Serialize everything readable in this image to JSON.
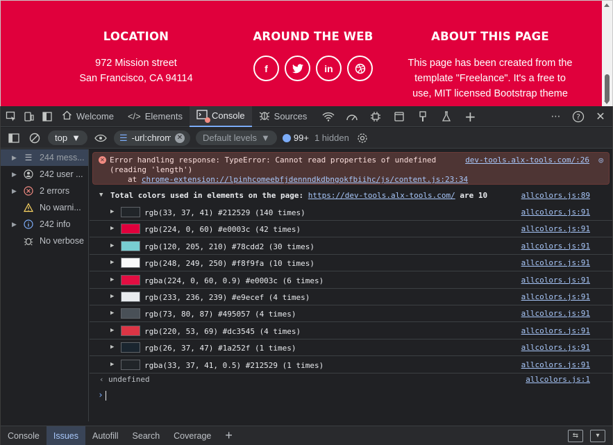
{
  "webpage": {
    "location": {
      "heading": "LOCATION",
      "line1": "972 Mission street",
      "line2": "San Francisco, CA 94114"
    },
    "around": {
      "heading": "AROUND THE WEB",
      "social": [
        {
          "icon": "facebook-icon",
          "glyph": "f"
        },
        {
          "icon": "twitter-icon",
          "glyph": "🐦"
        },
        {
          "icon": "linkedin-icon",
          "glyph": "in"
        },
        {
          "icon": "dribbble-icon",
          "glyph": "◎"
        }
      ]
    },
    "about": {
      "heading": "ABOUT THIS PAGE",
      "line1": "This page has been created from the",
      "line2": "template \"Freelance\". It's a free to",
      "line3": "use, MIT licensed Bootstrap theme"
    },
    "accent_color": "#e0003c"
  },
  "tabbar": {
    "tabs": [
      {
        "label": "Welcome",
        "icon": "home-icon"
      },
      {
        "label": "Elements",
        "icon": "code-icon"
      },
      {
        "label": "Console",
        "icon": "console-icon",
        "active": true
      },
      {
        "label": "Sources",
        "icon": "bug-icon"
      }
    ]
  },
  "toolbar": {
    "context": "top",
    "filter": "-url:chrome-",
    "levels": "Default levels",
    "issues_count": "99+",
    "hidden": "1 hidden"
  },
  "sidebar": {
    "items": [
      {
        "label": "244 mess...",
        "icon": "list-icon",
        "active": true
      },
      {
        "label": "242 user ...",
        "icon": "user-icon"
      },
      {
        "label": "2 errors",
        "icon": "error-icon"
      },
      {
        "label": "No warni...",
        "icon": "warning-icon"
      },
      {
        "label": "242 info",
        "icon": "info-icon"
      },
      {
        "label": "No verbose",
        "icon": "bug-icon"
      }
    ]
  },
  "console": {
    "error": {
      "line1": "Error handling response: TypeError: Cannot read properties of undefined",
      "line2": "(reading 'length')",
      "at": "at",
      "stack_link": "chrome-extension://lpinhcomeebfjdennndkdbngokfbiihc/js/content.js:23:34",
      "source": "dev-tools.alx-tools.com/:26"
    },
    "summary": {
      "prefix": "Total colors used in elements on the page:",
      "link": "https://dev-tools.alx-tools.com/",
      "suffix": "are 10",
      "source": "allcolors.js:89"
    },
    "colors": [
      {
        "text": "rgb(33, 37, 41) #212529 (140 times)",
        "swatch": "#212529",
        "source": "allcolors.js:91"
      },
      {
        "text": "rgb(224, 0, 60) #e0003c (42 times)",
        "swatch": "#e0003c",
        "source": "allcolors.js:91"
      },
      {
        "text": "rgb(120, 205, 210) #78cdd2 (30 times)",
        "swatch": "#78cdd2",
        "source": "allcolors.js:91"
      },
      {
        "text": "rgb(248, 249, 250) #f8f9fa (10 times)",
        "swatch": "#f8f9fa",
        "source": "allcolors.js:91"
      },
      {
        "text": "rgba(224, 0, 60, 0.9) #e0003c (6 times)",
        "swatch": "#e20e42",
        "source": "allcolors.js:91"
      },
      {
        "text": "rgb(233, 236, 239) #e9ecef (4 times)",
        "swatch": "#e9ecef",
        "source": "allcolors.js:91"
      },
      {
        "text": "rgb(73, 80, 87) #495057 (4 times)",
        "swatch": "#495057",
        "source": "allcolors.js:91"
      },
      {
        "text": "rgb(220, 53, 69) #dc3545 (4 times)",
        "swatch": "#dc3545",
        "source": "allcolors.js:91"
      },
      {
        "text": "rgb(26, 37, 47) #1a252f (1 times)",
        "swatch": "#1a252f",
        "source": "allcolors.js:91"
      },
      {
        "text": "rgba(33, 37, 41, 0.5) #212529 (1 times)",
        "swatch": "#212529",
        "source": "allcolors.js:91"
      }
    ],
    "result": {
      "text": "undefined",
      "source": "allcolors.js:1"
    }
  },
  "drawer": {
    "tabs": [
      {
        "label": "Console"
      },
      {
        "label": "Issues",
        "active": true
      },
      {
        "label": "Autofill"
      },
      {
        "label": "Search"
      },
      {
        "label": "Coverage"
      }
    ]
  }
}
